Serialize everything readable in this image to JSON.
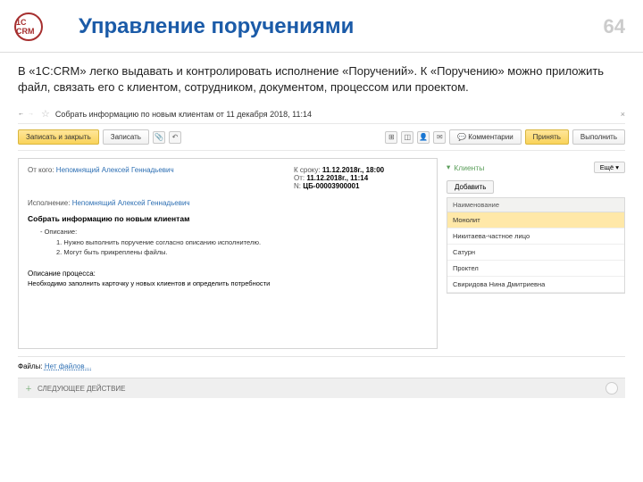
{
  "header": {
    "logo_text": "1C CRM",
    "title": "Управление поручениями",
    "page": "64"
  },
  "description": "В «1С:CRM» легко выдавать и контролировать исполнение «Поручений». К «Поручению» можно приложить файл, связать его с клиентом, сотрудником,  документом, процессом или проектом.",
  "app": {
    "title": "Собрать информацию по новым клиентам от 11 декабря 2018, 11:14",
    "toolbar": {
      "save_close": "Записать и закрыть",
      "save": "Записать",
      "comments": "Комментарии",
      "accept": "Принять",
      "execute": "Выполнить"
    },
    "left": {
      "from_lbl": "От кого:",
      "from_val": "Непомнящий Алексей Геннадьевич",
      "deadline_lbl": "К сроку:",
      "deadline_val": "11.12.2018г., 18:00",
      "from_date_lbl": "От:",
      "from_date_val": "11.12.2018г., 11:14",
      "num_lbl": "N:",
      "num_val": "ЦБ-00003900001",
      "exec_lbl": "Исполнение:",
      "exec_val": "Непомнящий Алексей Геннадьевич",
      "subject": "Собрать информацию по новым клиентам",
      "desc_lbl": "-   Описание:",
      "desc_item1": "1. Нужно выполнить поручение согласно описанию исполнителю.",
      "desc_item2": "2. Могут быть прикреплены файлы.",
      "process_lbl": "Описание процесса:",
      "process_val": "Необходимо заполнить карточку у новых клиентов и определить потребности"
    },
    "right": {
      "clients": "Клиенты",
      "more": "Ещё",
      "add": "Добавить",
      "th": "Наименование",
      "rows": [
        "Монолит",
        "Никитаева-частное лицо",
        "Сатурн",
        "Проктел",
        "Свиридова Нина Дмитриевна"
      ]
    },
    "files_lbl": "Файлы:",
    "files_link": "Нет файлов…",
    "footer": "СЛЕДУЮЩЕЕ ДЕЙСТВИЕ"
  }
}
